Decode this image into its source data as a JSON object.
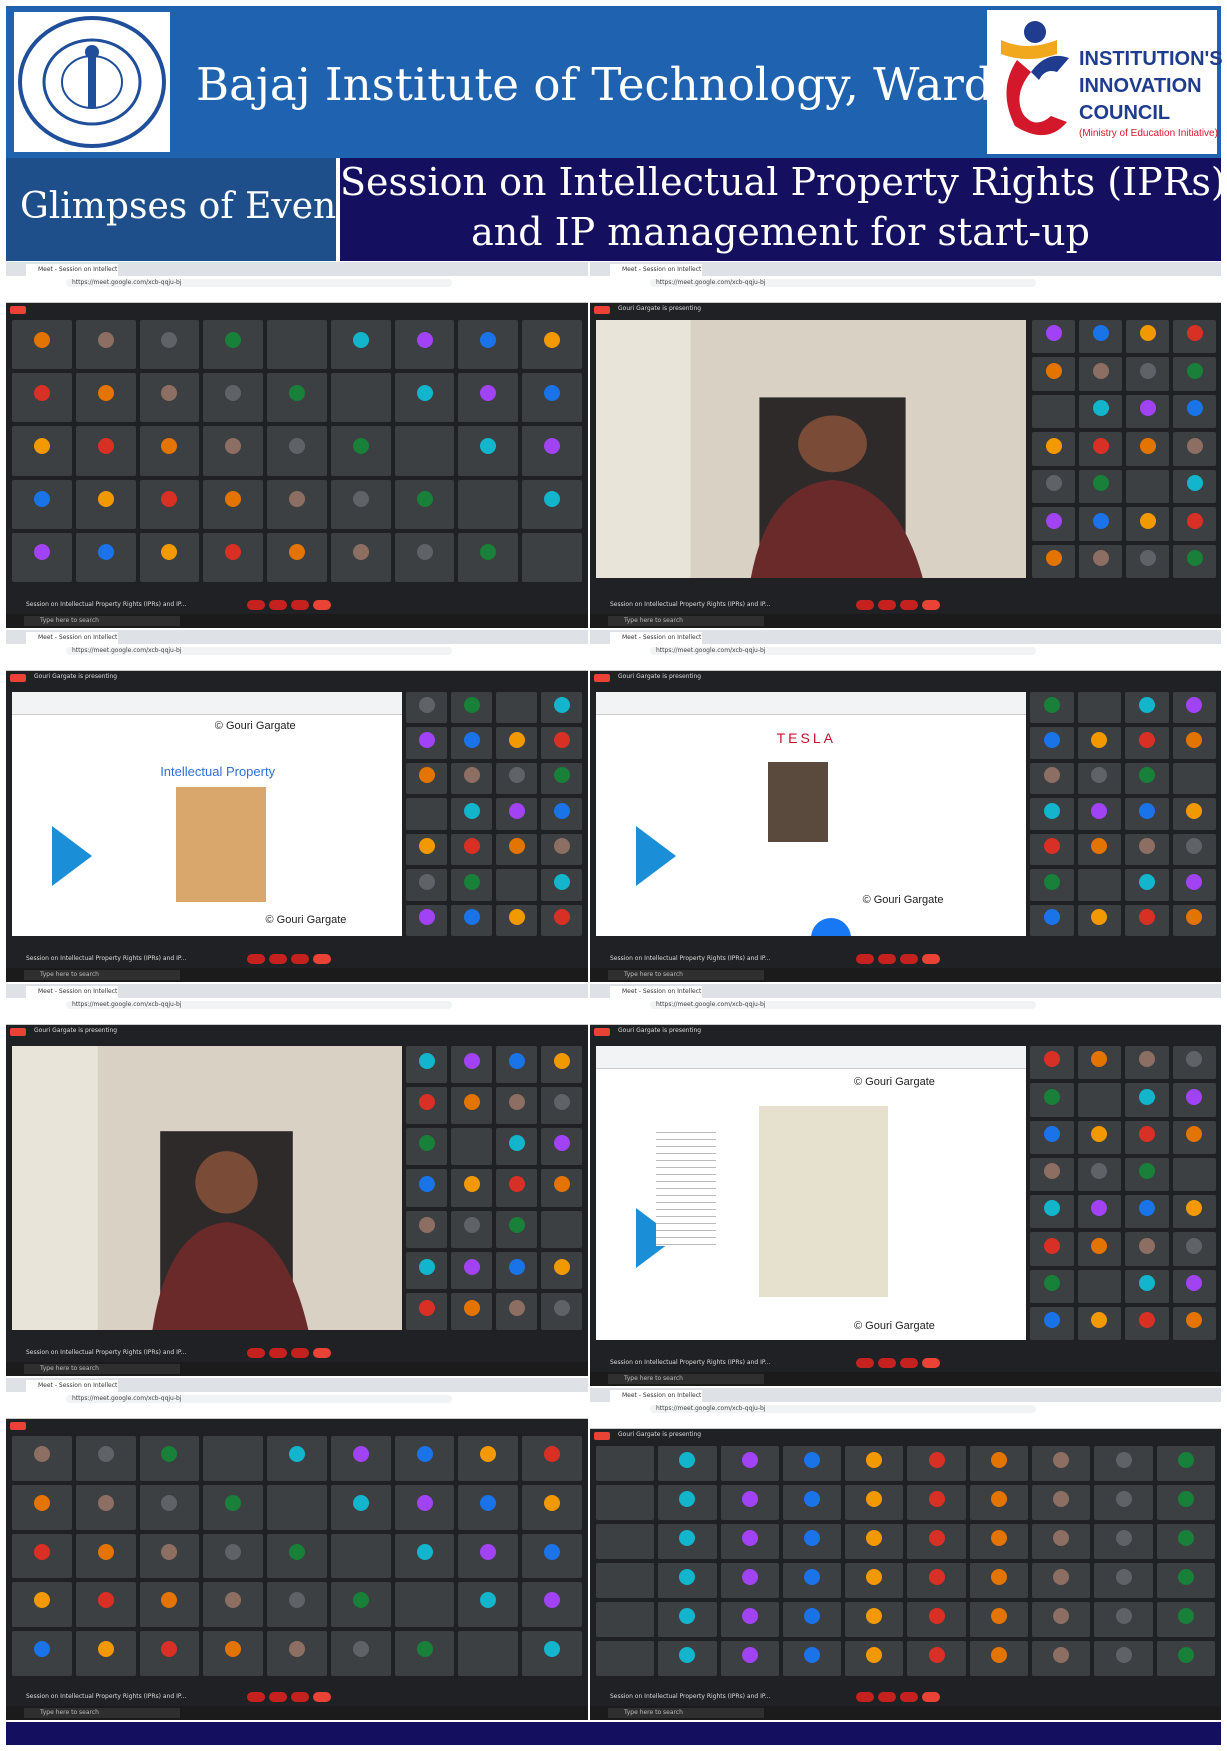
{
  "header": {
    "institute_name": "Bajaj Institute of Technology, Wardha",
    "iic_line1": "INSTITUTION'S",
    "iic_line2": "INNOVATION",
    "iic_line3": "COUNCIL",
    "iic_sub": "(Ministry of Education Initiative)"
  },
  "banner": {
    "left": "Glimpses of Event",
    "title_line1": "Session on Intellectual Property Rights (IPRs)",
    "title_line2": "and IP management for start-up"
  },
  "screens": {
    "tab_label": "Meet - Session on Intellect",
    "url": "https://meet.google.com/xcb-qqju-bj",
    "presenting": "Gouri Gargate is presenting",
    "meeting_title": "Session on Intellectual Property Rights (IPRs) and IP...",
    "search_text": "Type here to search",
    "slide1_title": "Intellectual Property",
    "credit": "Gouri Gargate",
    "tesla": "TESLA"
  },
  "colors": {
    "header_blue": "#1f63b0",
    "banner_navy": "#150f5f",
    "meet_dark": "#202124",
    "end_red": "#ea4335"
  }
}
